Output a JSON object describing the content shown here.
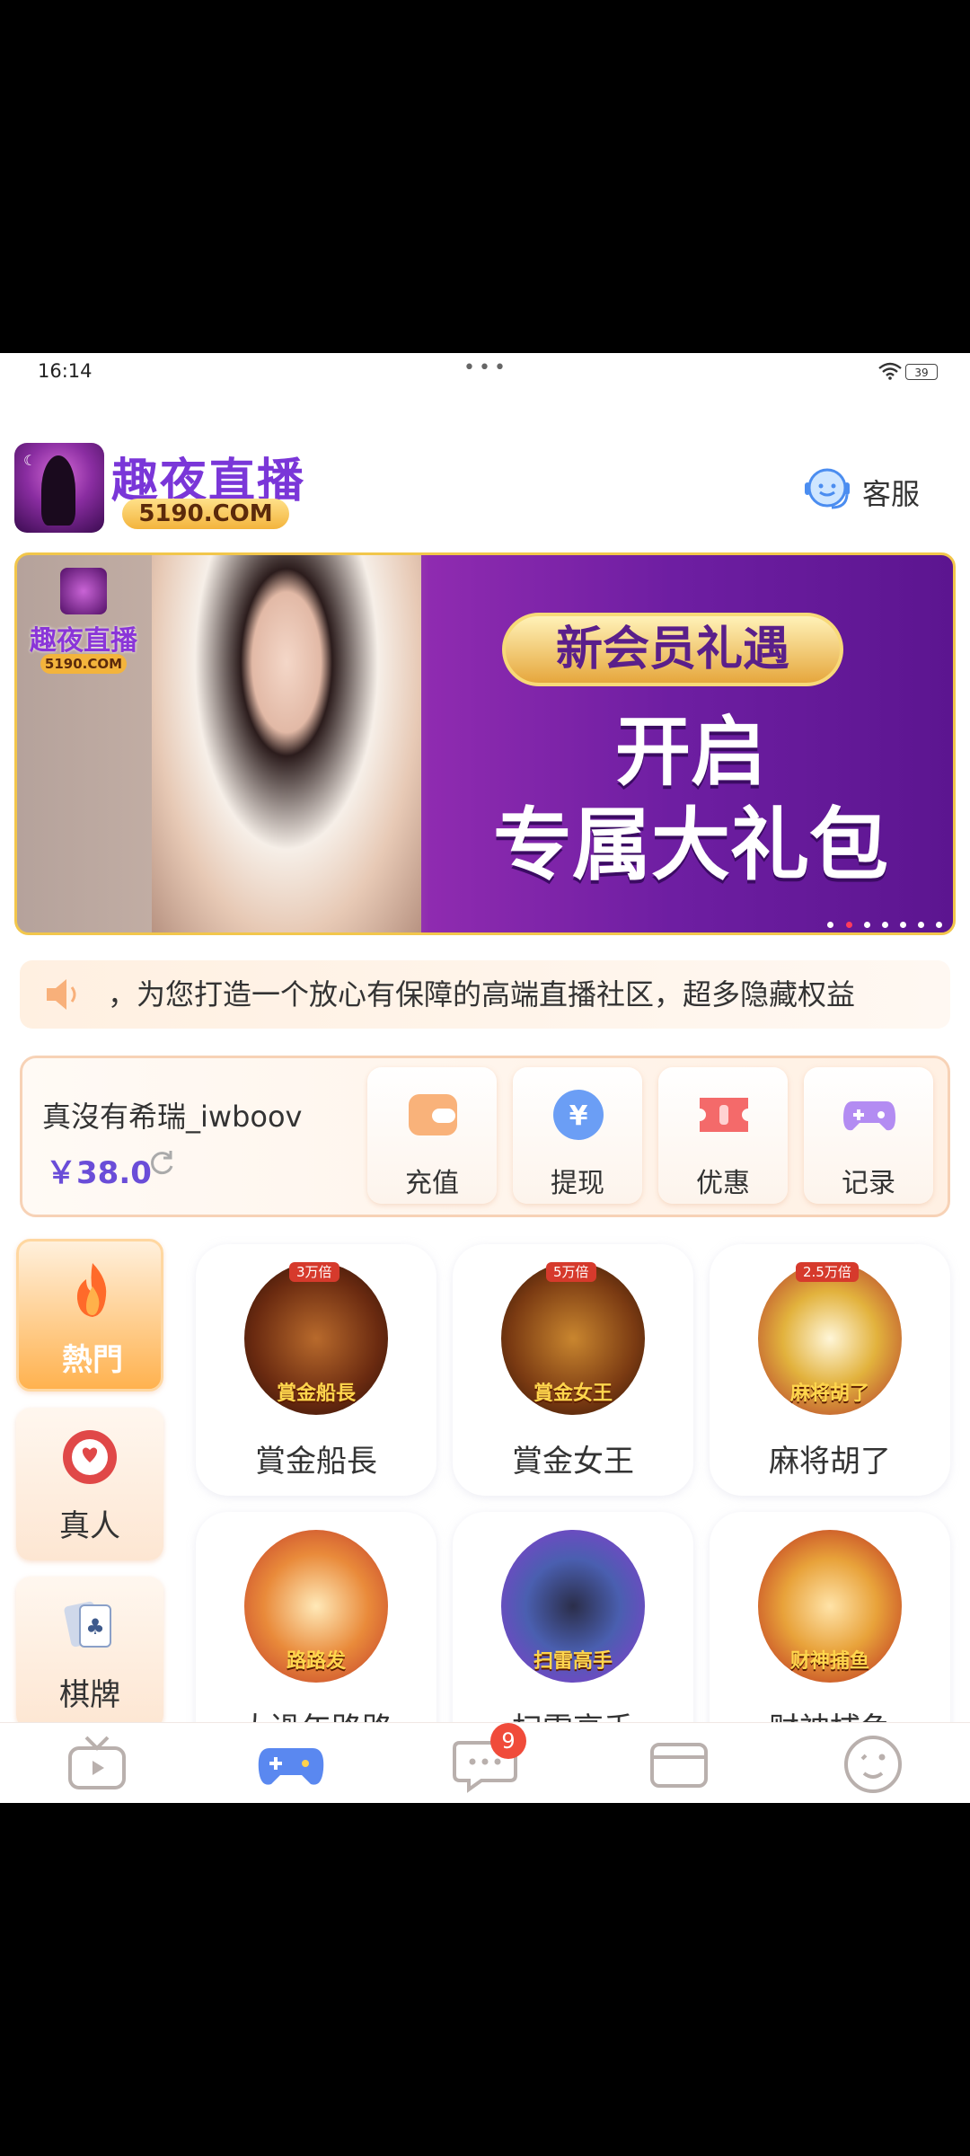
{
  "status": {
    "time": "16:14",
    "battery": "39"
  },
  "header": {
    "title": "趣夜直播",
    "domain_badge": "5190.COM",
    "service_label": "客服"
  },
  "banner": {
    "logo_title": "趣夜直播",
    "logo_domain": "5190.COM",
    "pill": "新会员礼遇",
    "line1": "开启",
    "line2": "专属大礼包",
    "pages": 7,
    "active_page": 2
  },
  "notice": {
    "text": "，为您打造一个放心有保障的高端直播社区，超多隐藏权益"
  },
  "wallet": {
    "username": "真沒有希瑞_iwboov",
    "balance": "￥38.0",
    "buttons": [
      {
        "label": "充值",
        "icon": "wallet-icon"
      },
      {
        "label": "提现",
        "icon": "yen-icon"
      },
      {
        "label": "优惠",
        "icon": "ticket-icon"
      },
      {
        "label": "记录",
        "icon": "gamepad-icon"
      }
    ]
  },
  "categories": [
    {
      "label": "熱門",
      "icon": "flame-icon",
      "active": true
    },
    {
      "label": "真人",
      "icon": "chip-icon",
      "active": false
    },
    {
      "label": "棋牌",
      "icon": "cards-icon",
      "active": false
    }
  ],
  "games": [
    {
      "name": "賞金船長",
      "art_title": "賞金船長",
      "badge": "3万倍"
    },
    {
      "name": "賞金女王",
      "art_title": "賞金女王",
      "badge": "5万倍"
    },
    {
      "name": "麻将胡了",
      "art_title": "麻将胡了",
      "badge": "2.5万倍"
    },
    {
      "name": "大過年路路",
      "art_title": "路路发",
      "badge": ""
    },
    {
      "name": "扫雷高手",
      "art_title": "扫雷高手",
      "badge": ""
    },
    {
      "name": "财神捕鱼",
      "art_title": "财神捕鱼",
      "badge": ""
    }
  ],
  "bottom_nav": {
    "messages_badge": "9"
  },
  "colors": {
    "accent": "#7a36d8",
    "balance": "#6a4dd8",
    "hot": "#ffb24f"
  }
}
